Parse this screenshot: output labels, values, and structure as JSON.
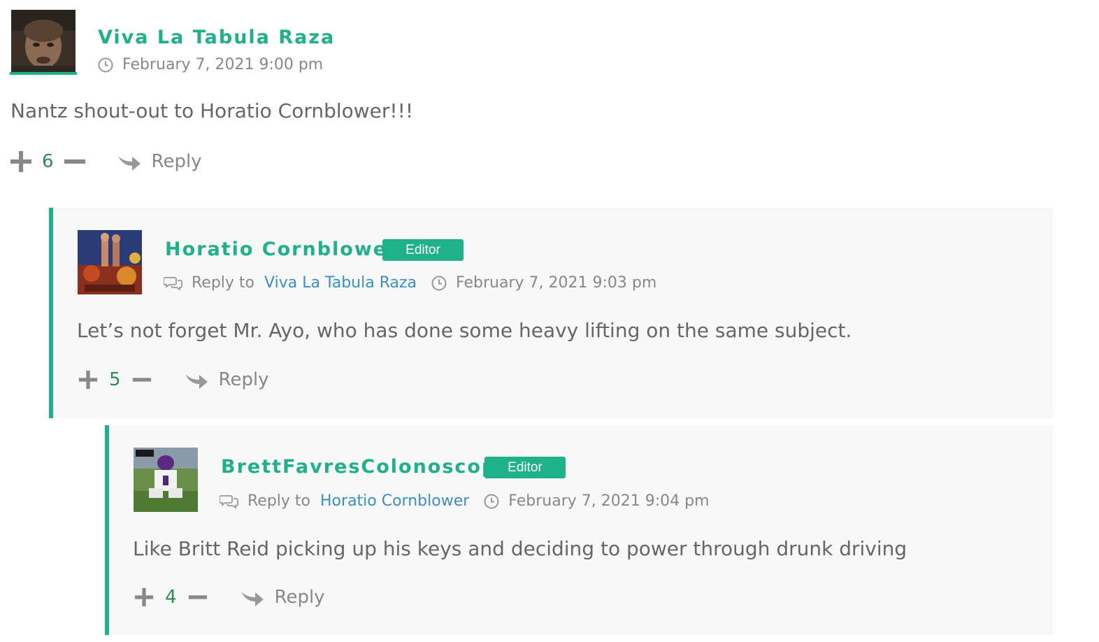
{
  "comments": [
    {
      "author": "Viva La Tabula Raza",
      "date": "February 7, 2021 9:00 pm",
      "text": "Nantz shout-out to Horatio Cornblower!!!",
      "votes": "6",
      "reply_label": "Reply"
    },
    {
      "author": "Horatio Cornblower",
      "badge": "Editor",
      "reply_to_label": "Reply to",
      "reply_to": "Viva La Tabula Raza",
      "date": "February 7, 2021 9:03 pm",
      "text": "Let’s not forget Mr. Ayo, who has done some heavy lifting on the same subject.",
      "votes": "5",
      "reply_label": "Reply"
    },
    {
      "author": "BrettFavresColonoscopy",
      "badge": "Editor",
      "reply_to_label": "Reply to",
      "reply_to": "Horatio Cornblower",
      "date": "February 7, 2021 9:04 pm",
      "text": "Like Britt Reid picking up his keys and deciding to power through drunk driving",
      "votes": "4",
      "reply_label": "Reply"
    }
  ],
  "icons": {
    "clock": "clock-icon",
    "chat": "chat-bubbles-icon",
    "plus": "plus-icon",
    "minus": "minus-icon",
    "reply": "reply-arrow-icon"
  },
  "colors": {
    "accent": "#1fb18a",
    "link": "#3a8fc7",
    "vote_count": "#2e8b57",
    "thread_bg": "#f8f8f8"
  }
}
